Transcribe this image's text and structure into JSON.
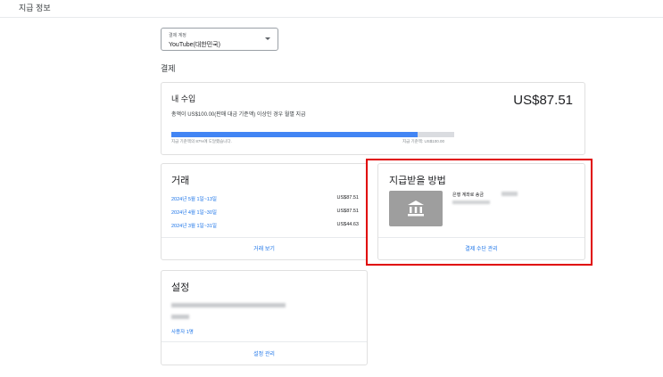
{
  "header": {
    "title": "지급 정보"
  },
  "account_select": {
    "label": "결제 계정",
    "value": "YouTube(대한민국)"
  },
  "section": {
    "title": "결제"
  },
  "earnings": {
    "title": "내 수입",
    "amount": "US$87.51",
    "threshold_note": "총액이 US$100.00(판매 대금 기준액) 이상인 경우 월별 지급",
    "progress_fraction": 0.87,
    "progress_left_label": "지급 기준액의 87%에 도달했습니다.",
    "progress_right_label": "지급 기준액: US$100.00",
    "colors": {
      "fill": "#4285f4",
      "track": "#dadce0"
    }
  },
  "transactions": {
    "title": "거래",
    "rows": [
      {
        "date": "2024년 5월 1일~13일",
        "amount": "US$87.51"
      },
      {
        "date": "2024년 4월 1일~30일",
        "amount": "US$87.51"
      },
      {
        "date": "2024년 3월 1일~31일",
        "amount": "US$44.63"
      }
    ],
    "link": "거래 보기"
  },
  "payment_method": {
    "title": "지급받을 방법",
    "label": "은행 계좌로 송금",
    "icon": "bank-icon",
    "link": "결제 수단 관리",
    "highlight_color": "#e00000"
  },
  "settings": {
    "title": "설정",
    "users_link": "사용자 1명",
    "link": "설정 관리"
  }
}
